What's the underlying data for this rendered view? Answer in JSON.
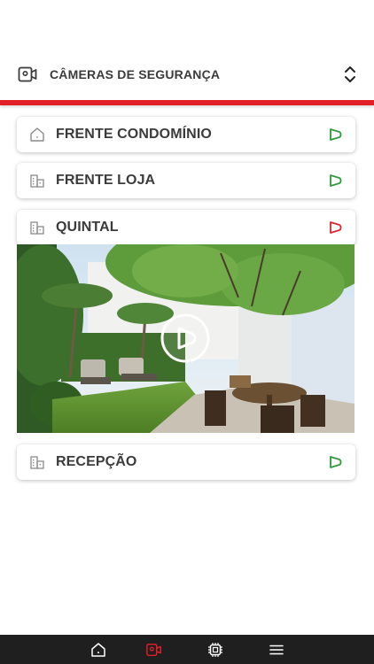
{
  "header": {
    "title": "CÂMERAS DE SEGURANÇA",
    "icon": "camera-icon",
    "toggle_icon": "chevron-up-down-icon"
  },
  "cameras": [
    {
      "label": "FRENTE CONDOMÍNIO",
      "icon": "house-icon",
      "status": "online",
      "status_color": "#2e9b3a"
    },
    {
      "label": "FRENTE LOJA",
      "icon": "building-icon",
      "status": "online",
      "status_color": "#2e9b3a"
    },
    {
      "label": "QUINTAL",
      "icon": "building-icon",
      "status": "active",
      "status_color": "#d9262e",
      "expanded": true
    },
    {
      "label": "RECEPÇÃO",
      "icon": "building-icon",
      "status": "online",
      "status_color": "#2e9b3a"
    }
  ],
  "preview": {
    "play_icon": "play-icon"
  },
  "bottom_nav": [
    {
      "name": "home",
      "icon": "home-icon",
      "active": false
    },
    {
      "name": "cameras",
      "icon": "camera-icon",
      "active": true
    },
    {
      "name": "devices",
      "icon": "chip-icon",
      "active": false
    },
    {
      "name": "menu",
      "icon": "menu-icon",
      "active": false
    }
  ],
  "colors": {
    "accent": "#e41e26",
    "online": "#2e9b3a",
    "active": "#d9262e",
    "nav_bg": "#1f1f1f"
  }
}
